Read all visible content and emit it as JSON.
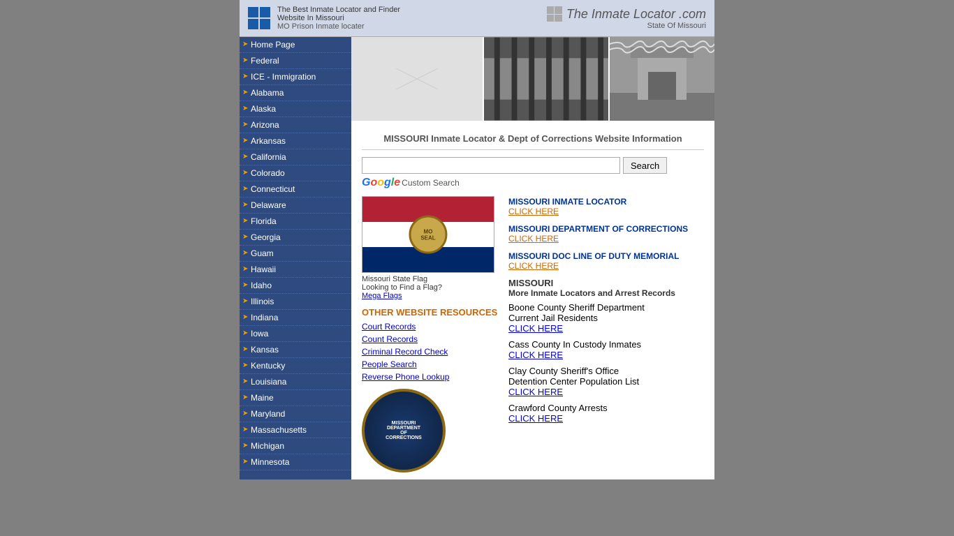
{
  "header": {
    "site_title": "The Best Inmate Locator and Finder",
    "state_name": "Website In Missouri",
    "sub_title": "MO Prison Inmate locater",
    "brand_name": "The Inmate Locator .com",
    "brand_state": "State Of Missouri"
  },
  "sidebar": {
    "items": [
      {
        "label": "Home Page",
        "id": "home"
      },
      {
        "label": "Federal",
        "id": "federal"
      },
      {
        "label": "ICE - Immigration",
        "id": "ice"
      },
      {
        "label": "Alabama",
        "id": "alabama"
      },
      {
        "label": "Alaska",
        "id": "alaska"
      },
      {
        "label": "Arizona",
        "id": "arizona"
      },
      {
        "label": "Arkansas",
        "id": "arkansas"
      },
      {
        "label": "California",
        "id": "california"
      },
      {
        "label": "Colorado",
        "id": "colorado"
      },
      {
        "label": "Connecticut",
        "id": "connecticut"
      },
      {
        "label": "Delaware",
        "id": "delaware"
      },
      {
        "label": "Florida",
        "id": "florida"
      },
      {
        "label": "Georgia",
        "id": "georgia"
      },
      {
        "label": "Guam",
        "id": "guam"
      },
      {
        "label": "Hawaii",
        "id": "hawaii"
      },
      {
        "label": "Idaho",
        "id": "idaho"
      },
      {
        "label": "Illinois",
        "id": "illinois"
      },
      {
        "label": "Indiana",
        "id": "indiana"
      },
      {
        "label": "Iowa",
        "id": "iowa"
      },
      {
        "label": "Kansas",
        "id": "kansas"
      },
      {
        "label": "Kentucky",
        "id": "kentucky"
      },
      {
        "label": "Louisiana",
        "id": "louisiana"
      },
      {
        "label": "Maine",
        "id": "maine"
      },
      {
        "label": "Maryland",
        "id": "maryland"
      },
      {
        "label": "Massachusetts",
        "id": "massachusetts"
      },
      {
        "label": "Michigan",
        "id": "michigan"
      },
      {
        "label": "Minnesota",
        "id": "minnesota"
      }
    ]
  },
  "content": {
    "page_heading": "MISSOURI Inmate Locator & Dept of Corrections Website Information",
    "search_button": "Search",
    "custom_search": "Custom Search",
    "flag_caption": "Missouri State Flag",
    "flag_caption2": "Looking to Find a Flag?",
    "flag_link": "Mega Flags",
    "mo_links": [
      {
        "title": "MISSOURI INMATE LOCATOR",
        "click": "CLICK HERE",
        "id": "inmate-locator"
      },
      {
        "title": "MISSOURI DEPARTMENT OF CORRECTIONS",
        "click": "CLICK HERE",
        "id": "dept-corrections"
      },
      {
        "title": "MISSOURI DOC LINE OF DUTY MEMORIAL",
        "click": "CLICK HERE",
        "id": "doc-memorial"
      }
    ],
    "other_resources_heading": "OTHER WEBSITE RESOURCES",
    "other_resources": [
      {
        "label": "Court Records",
        "id": "court-records"
      },
      {
        "label": "Count Records",
        "id": "count-records"
      },
      {
        "label": "Criminal Record Check",
        "id": "criminal-record"
      },
      {
        "label": "People Search",
        "id": "people-search"
      },
      {
        "label": "Reverse Phone Lookup",
        "id": "reverse-phone"
      }
    ],
    "missouri_more_heading": "MISSOURI",
    "missouri_more_sub": "More Inmate Locators and Arrest Records",
    "counties": [
      {
        "name": "Boone County",
        "dept": "Sheriff Department",
        "detail": "Current Jail Residents",
        "click": "CLICK HERE"
      },
      {
        "name": "Cass County",
        "dept": "In Custody Inmates",
        "detail": "",
        "click": "CLICK HERE"
      },
      {
        "name": "Clay County",
        "dept": "Sheriff's Office",
        "detail": "Detention Center Population List",
        "click": "CLICK HERE"
      },
      {
        "name": "Crawford County",
        "dept": "Arrests",
        "detail": "",
        "click": "CLICK HERE"
      }
    ]
  }
}
